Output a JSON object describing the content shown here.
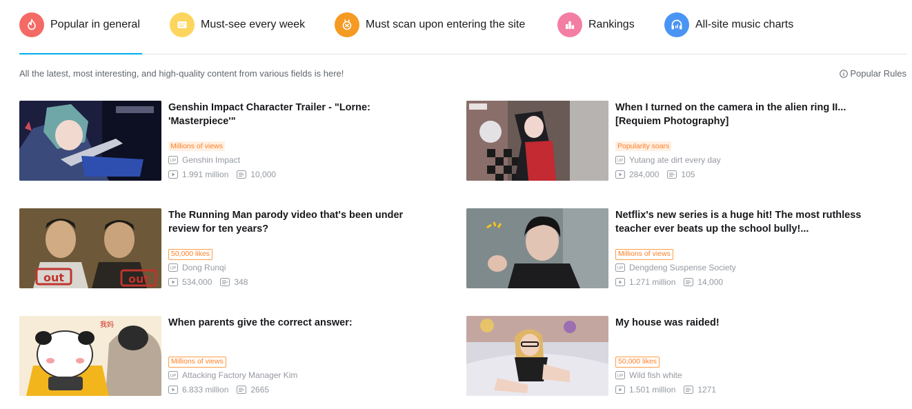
{
  "tabs": [
    {
      "label": "Popular in general",
      "icon": "flame-icon",
      "color": "#f46a65"
    },
    {
      "label": "Must-see every week",
      "icon": "calendar-icon",
      "color": "#fcd55e"
    },
    {
      "label": "Must scan upon entering the site",
      "icon": "medal-icon",
      "color": "#f59a23"
    },
    {
      "label": "Rankings",
      "icon": "bar-chart-icon",
      "color": "#f37ea3"
    },
    {
      "label": "All-site music charts",
      "icon": "headphones-icon",
      "color": "#4a94f3"
    }
  ],
  "active_tab": "Popular in general",
  "subtitle": "All the latest, most interesting, and high-quality content from various fields is here!",
  "rules_label": "Popular Rules",
  "videos": [
    {
      "title": "Genshin Impact Character Trailer - \"Lorne: 'Masterpiece'\"",
      "badge": "Millions of views",
      "badge_style": "filled",
      "uploader": "Genshin Impact",
      "views": "1.991 million",
      "danmaku": "10,000"
    },
    {
      "title": "When I turned on the camera in the alien ring II... [Requiem Photography]",
      "badge": "Popularity soars",
      "badge_style": "filled",
      "uploader": "Yutang ate dirt every day",
      "views": "284,000",
      "danmaku": "105"
    },
    {
      "title": "The Running Man parody video that's been under review for ten years?",
      "badge": "50,000 likes",
      "badge_style": "outline",
      "uploader": "Dong Runqi",
      "views": "534,000",
      "danmaku": "348"
    },
    {
      "title": "Netflix's new series is a huge hit! The most ruthless teacher ever beats up the school bully!...",
      "badge": "Millions of views",
      "badge_style": "outline",
      "uploader": "Dengdeng Suspense Society",
      "views": "1.271 million",
      "danmaku": "14,000"
    },
    {
      "title": "When parents give the correct answer:",
      "badge": "Millions of views",
      "badge_style": "outline",
      "uploader": "Attacking Factory Manager Kim",
      "views": "6.833 million",
      "danmaku": "2665"
    },
    {
      "title": "My house was raided!",
      "badge": "50,000 likes",
      "badge_style": "outline",
      "uploader": "Wild fish white",
      "views": "1.501 million",
      "danmaku": "1271"
    }
  ],
  "thumb_text": {
    "out_left": "out",
    "out_right": "out",
    "meme_caption": "我妈"
  },
  "colors": {
    "accent": "#00aeec",
    "badge_text": "#ff7f24",
    "badge_bg": "#fff0e3"
  }
}
